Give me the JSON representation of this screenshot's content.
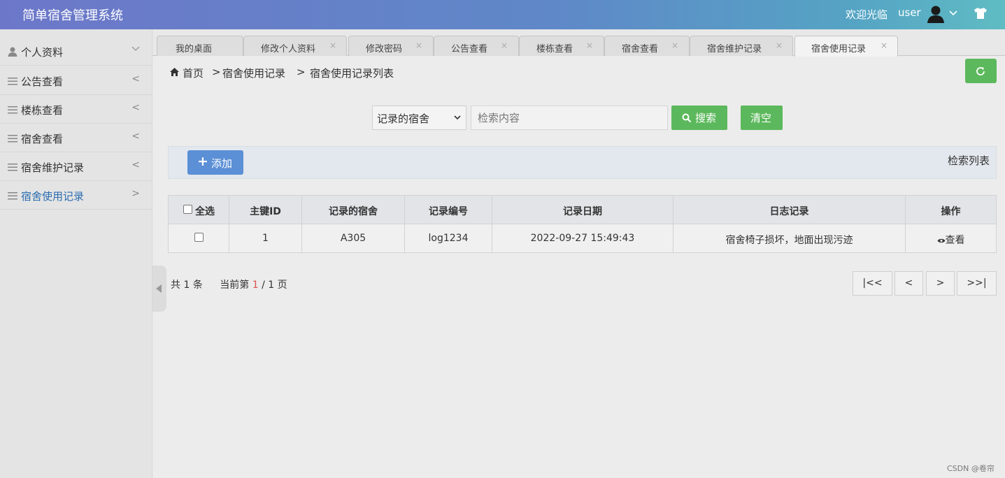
{
  "header": {
    "title": "简单宿舍管理系统",
    "welcome": "欢迎光临",
    "username": "user"
  },
  "sidebar": {
    "items": [
      {
        "label": "个人资料",
        "icon": "user-icon",
        "arrow": "∨"
      },
      {
        "label": "公告查看",
        "icon": "list-icon",
        "arrow": "<"
      },
      {
        "label": "楼栋查看",
        "icon": "list-icon",
        "arrow": "<"
      },
      {
        "label": "宿舍查看",
        "icon": "list-icon",
        "arrow": "<"
      },
      {
        "label": "宿舍维护记录",
        "icon": "list-icon",
        "arrow": "<"
      },
      {
        "label": "宿舍使用记录",
        "icon": "list-icon",
        "arrow": ">",
        "active": true
      }
    ]
  },
  "tabs": [
    {
      "label": "我的桌面",
      "closable": false
    },
    {
      "label": "修改个人资料",
      "closable": true
    },
    {
      "label": "修改密码",
      "closable": true
    },
    {
      "label": "公告查看",
      "closable": true
    },
    {
      "label": "楼栋查看",
      "closable": true
    },
    {
      "label": "宿舍查看",
      "closable": true
    },
    {
      "label": "宿舍维护记录",
      "closable": true
    },
    {
      "label": "宿舍使用记录",
      "closable": true,
      "active": true
    }
  ],
  "tab_close": "×",
  "breadcrumb": {
    "home": "首页",
    "sep": ">",
    "level2": "宿舍使用记录",
    "level3": "宿舍使用记录列表"
  },
  "search": {
    "field_selected": "记录的宿舍",
    "placeholder": "检索内容",
    "search_label": "搜索",
    "clear_label": "清空"
  },
  "list": {
    "add_label": "添加",
    "title": "检索列表"
  },
  "table": {
    "select_all": "全选",
    "columns": [
      "主键ID",
      "记录的宿舍",
      "记录编号",
      "记录日期",
      "日志记录",
      "操作"
    ],
    "rows": [
      {
        "id": "1",
        "dorm": "A305",
        "code": "log1234",
        "date": "2022-09-27 15:49:43",
        "log": "宿舍椅子损坏，地面出现污迹",
        "action": "查看"
      }
    ]
  },
  "pagination": {
    "total_prefix": "共",
    "total": "1",
    "total_suffix": "条",
    "current_prefix": "当前第",
    "current": "1",
    "slash": "/",
    "pages": "1",
    "pages_suffix": "页",
    "first": "|<<",
    "prev": "<",
    "next": ">",
    "last": ">>|"
  },
  "watermark": "CSDN @卷帘",
  "colors": {
    "accent_green": "#5cb85c",
    "accent_blue": "#5b8fd6",
    "active_link": "#2b6cb0",
    "page_current": "#d9534f"
  }
}
